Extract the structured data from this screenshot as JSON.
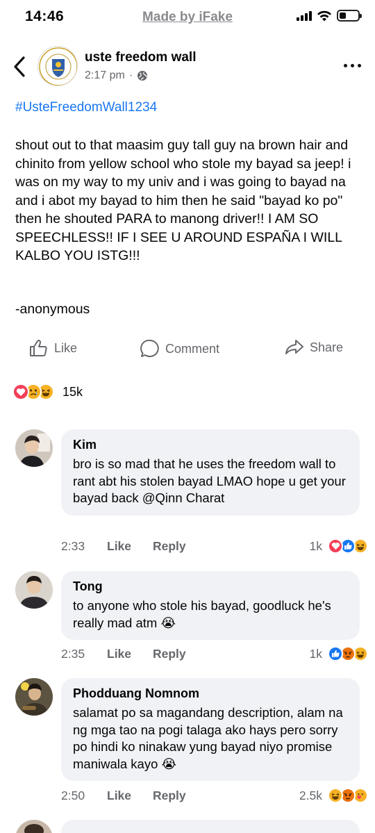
{
  "status_bar": {
    "time": "14:46",
    "watermark": "Made by iFake"
  },
  "post": {
    "page_name": "uste freedom wall",
    "time": "2:17 pm",
    "audience_icon": "globe-icon",
    "hashtag": "#UsteFreedomWall1234",
    "body": "shout out to that maasim guy tall guy na brown hair and chinito from yellow school who stole my bayad sa jeep! i was on my way to my univ and i was going to bayad na and i abot my bayad to him then he said \"bayad ko po\" then he shouted PARA to manong driver!! I AM SO SPEECHLESS!! IF I SEE U AROUND ESPAÑA I WILL KALBO YOU ISTG!!!",
    "signature": "-anonymous"
  },
  "actions": {
    "like": "Like",
    "comment": "Comment",
    "share": "Share"
  },
  "reactions": {
    "icons": [
      "love",
      "sad",
      "haha"
    ],
    "count": "15k"
  },
  "comments": [
    {
      "name": "Kim",
      "text": "bro is so mad that he uses the freedom wall to rant abt his stolen bayad LMAO hope u get your bayad back @Qinn Charat",
      "time": "2:33",
      "like": "Like",
      "reply": "Reply",
      "reaction_count": "1k",
      "reactions": [
        "love",
        "like",
        "haha"
      ]
    },
    {
      "name": "Tong",
      "text": "to anyone who stole his bayad, goodluck he's really mad atm 😭",
      "time": "2:35",
      "like": "Like",
      "reply": "Reply",
      "reaction_count": "1k",
      "reactions": [
        "like",
        "angry",
        "haha"
      ]
    },
    {
      "name": "Phodduang Nomnom",
      "text": "salamat po sa magandang description, alam na ng mga tao na pogi talaga ako hays pero sorry po hindi ko ninakaw yung bayad niyo promise maniwala kayo 😭",
      "time": "2:50",
      "like": "Like",
      "reply": "Reply",
      "reaction_count": "2.5k",
      "reactions": [
        "haha",
        "angry",
        "care"
      ]
    }
  ],
  "colors": {
    "link": "#1877f2",
    "muted": "#65676b",
    "bubble": "#f0f2f5",
    "love": "#f33e58",
    "like": "#1877f2",
    "emoji": "#f7b125",
    "angry": "#e9710f"
  }
}
